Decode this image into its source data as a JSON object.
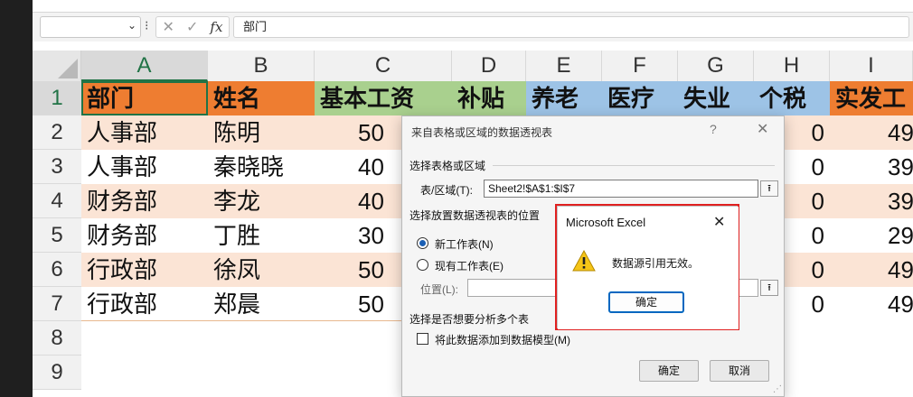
{
  "colors": {
    "orange": "#ee7d31",
    "peach": "#fbe4d5",
    "green": "#a9d08e",
    "blue": "#9dc3e6",
    "selection": "#217346",
    "alert_border": "#e02020"
  },
  "formula_bar": {
    "name_box_value": "",
    "separator": "⁝",
    "cancel_icon": "✕",
    "enter_icon": "✓",
    "fx_label": "fx",
    "formula_value": "部门"
  },
  "sheet": {
    "columns": [
      "A",
      "B",
      "C",
      "D",
      "E",
      "F",
      "G",
      "H",
      "I"
    ],
    "row_numbers": [
      "1",
      "2",
      "3",
      "4",
      "5",
      "6",
      "7",
      "8",
      "9"
    ],
    "header_row": [
      "部门",
      "姓名",
      "基本工资",
      "补贴",
      "养老",
      "医疗",
      "失业",
      "个税",
      "实发工"
    ],
    "rows": [
      {
        "dept": "人事部",
        "name": "陈明",
        "base": "50",
        "tax": "0",
        "net": "49"
      },
      {
        "dept": "人事部",
        "name": "秦晓晓",
        "base": "40",
        "tax": "0",
        "net": "39"
      },
      {
        "dept": "财务部",
        "name": "李龙",
        "base": "40",
        "tax": "0",
        "net": "39"
      },
      {
        "dept": "财务部",
        "name": "丁胜",
        "base": "30",
        "tax": "0",
        "net": "29"
      },
      {
        "dept": "行政部",
        "name": "徐凤",
        "base": "50",
        "tax": "0",
        "net": "49"
      },
      {
        "dept": "行政部",
        "name": "郑晨",
        "base": "50",
        "tax": "0",
        "net": "49"
      }
    ]
  },
  "pivot_dialog": {
    "title": "来自表格或区域的数据透视表",
    "help": "?",
    "close": "✕",
    "section_source": "选择表格或区域",
    "range_label": "表/区域(T):",
    "range_value": "Sheet2!$A$1:$I$7",
    "collapse_icon": "⭱",
    "section_location": "选择放置数据透视表的位置",
    "option_new": "新工作表(N)",
    "option_existing": "现有工作表(E)",
    "location_label": "位置(L):",
    "section_analyze": "选择是否想要分析多个表",
    "model_checkbox": "将此数据添加到数据模型(M)",
    "ok_label": "确定",
    "cancel_label": "取消"
  },
  "error_popup": {
    "title": "Microsoft Excel",
    "close": "✕",
    "message": "数据源引用无效。",
    "ok_label": "确定"
  }
}
